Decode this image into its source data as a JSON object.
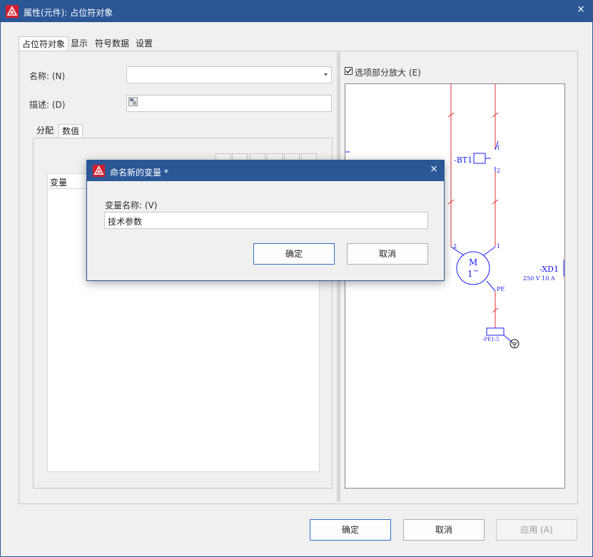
{
  "window": {
    "title": "属性(元件): 占位符对象",
    "close_glyph": "×"
  },
  "main_tabs": [
    {
      "label": "占位符对象",
      "active": true
    },
    {
      "label": "显示",
      "active": false
    },
    {
      "label": "符号数据",
      "active": false
    },
    {
      "label": "设置",
      "active": false
    }
  ],
  "form": {
    "name_label": "名称: (N)",
    "name_value": "",
    "desc_label": "描述: (D)",
    "desc_value": ""
  },
  "sub_tabs": [
    {
      "label": "分配",
      "active": false
    },
    {
      "label": "数值",
      "active": true
    }
  ],
  "list": {
    "column_header": "变量"
  },
  "preview": {
    "checkbox_label": "选项部分放大 (E)",
    "checked": true,
    "labels": {
      "bt1": "-BT1",
      "m": "M",
      "one": "1",
      "tilde": "~",
      "xd1": "-XD1",
      "xd1_rating": "250 V 10 A",
      "pe": "PE",
      "pe_term": "-PE1:5",
      "t1": "1",
      "t2": "2",
      "t3": "1",
      "t4": "2",
      "t5": "1"
    },
    "colors": {
      "wire_red": "#e03030",
      "symbol_blue": "#1a1aff"
    }
  },
  "bottom_buttons": {
    "ok": "确定",
    "cancel": "取消",
    "apply": "应用 (A)"
  },
  "dialog": {
    "title": "命名新的变量 *",
    "close_glyph": "×",
    "field_label": "变量名称: (V)",
    "field_value": "技术参数",
    "ok": "确定",
    "cancel": "取消"
  }
}
